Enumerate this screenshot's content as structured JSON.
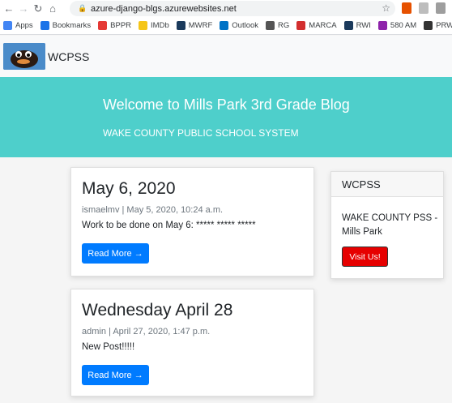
{
  "browser": {
    "url": "azure-django-blgs.azurewebsites.net",
    "bookmarks": [
      {
        "label": "Apps",
        "icon": "apps-grid-icon",
        "color": "#4285f4"
      },
      {
        "label": "Bookmarks",
        "icon": "star-icon",
        "color": "#1a73e8"
      },
      {
        "label": "BPPR",
        "icon": "bppr-icon",
        "color": "#e53935"
      },
      {
        "label": "IMDb",
        "icon": "imdb-icon",
        "color": "#f5c518"
      },
      {
        "label": "MWRF",
        "icon": "mwrf-icon",
        "color": "#1b3a5c"
      },
      {
        "label": "Outlook",
        "icon": "outlook-icon",
        "color": "#0072c6"
      },
      {
        "label": "RG",
        "icon": "rg-icon",
        "color": "#555555"
      },
      {
        "label": "MARCA",
        "icon": "marca-icon",
        "color": "#d32f2f"
      },
      {
        "label": "RWI",
        "icon": "rwi-icon",
        "color": "#1b3a5c"
      },
      {
        "label": "580 AM",
        "icon": "580am-icon",
        "color": "#8e24aa"
      },
      {
        "label": "PRW",
        "icon": "prw-icon",
        "color": "#333333"
      },
      {
        "label": "",
        "icon": "extra-bookmark-icon",
        "color": "#333333"
      }
    ]
  },
  "site": {
    "brand": "WCPSS"
  },
  "hero": {
    "title": "Welcome to Mills Park 3rd Grade Blog",
    "subtitle": "WAKE COUNTY PUBLIC SCHOOL SYSTEM"
  },
  "posts": [
    {
      "title": "May 6, 2020",
      "meta": "ismaelmv | May 5, 2020, 10:24 a.m.",
      "body": "Work to be done on May 6: ***** ***** *****",
      "button": "Read More →"
    },
    {
      "title": "Wednesday April 28",
      "meta": "admin | April 27, 2020, 1:47 p.m.",
      "body": "New Post!!!!!",
      "button": "Read More →"
    }
  ],
  "sidebar": {
    "header": "WCPSS",
    "text": "WAKE COUNTY PSS - Mills Park",
    "button": "Visit Us!"
  },
  "colors": {
    "hero_bg": "#4ecfcb",
    "primary_button": "#007bff",
    "visit_button": "#e60000"
  }
}
